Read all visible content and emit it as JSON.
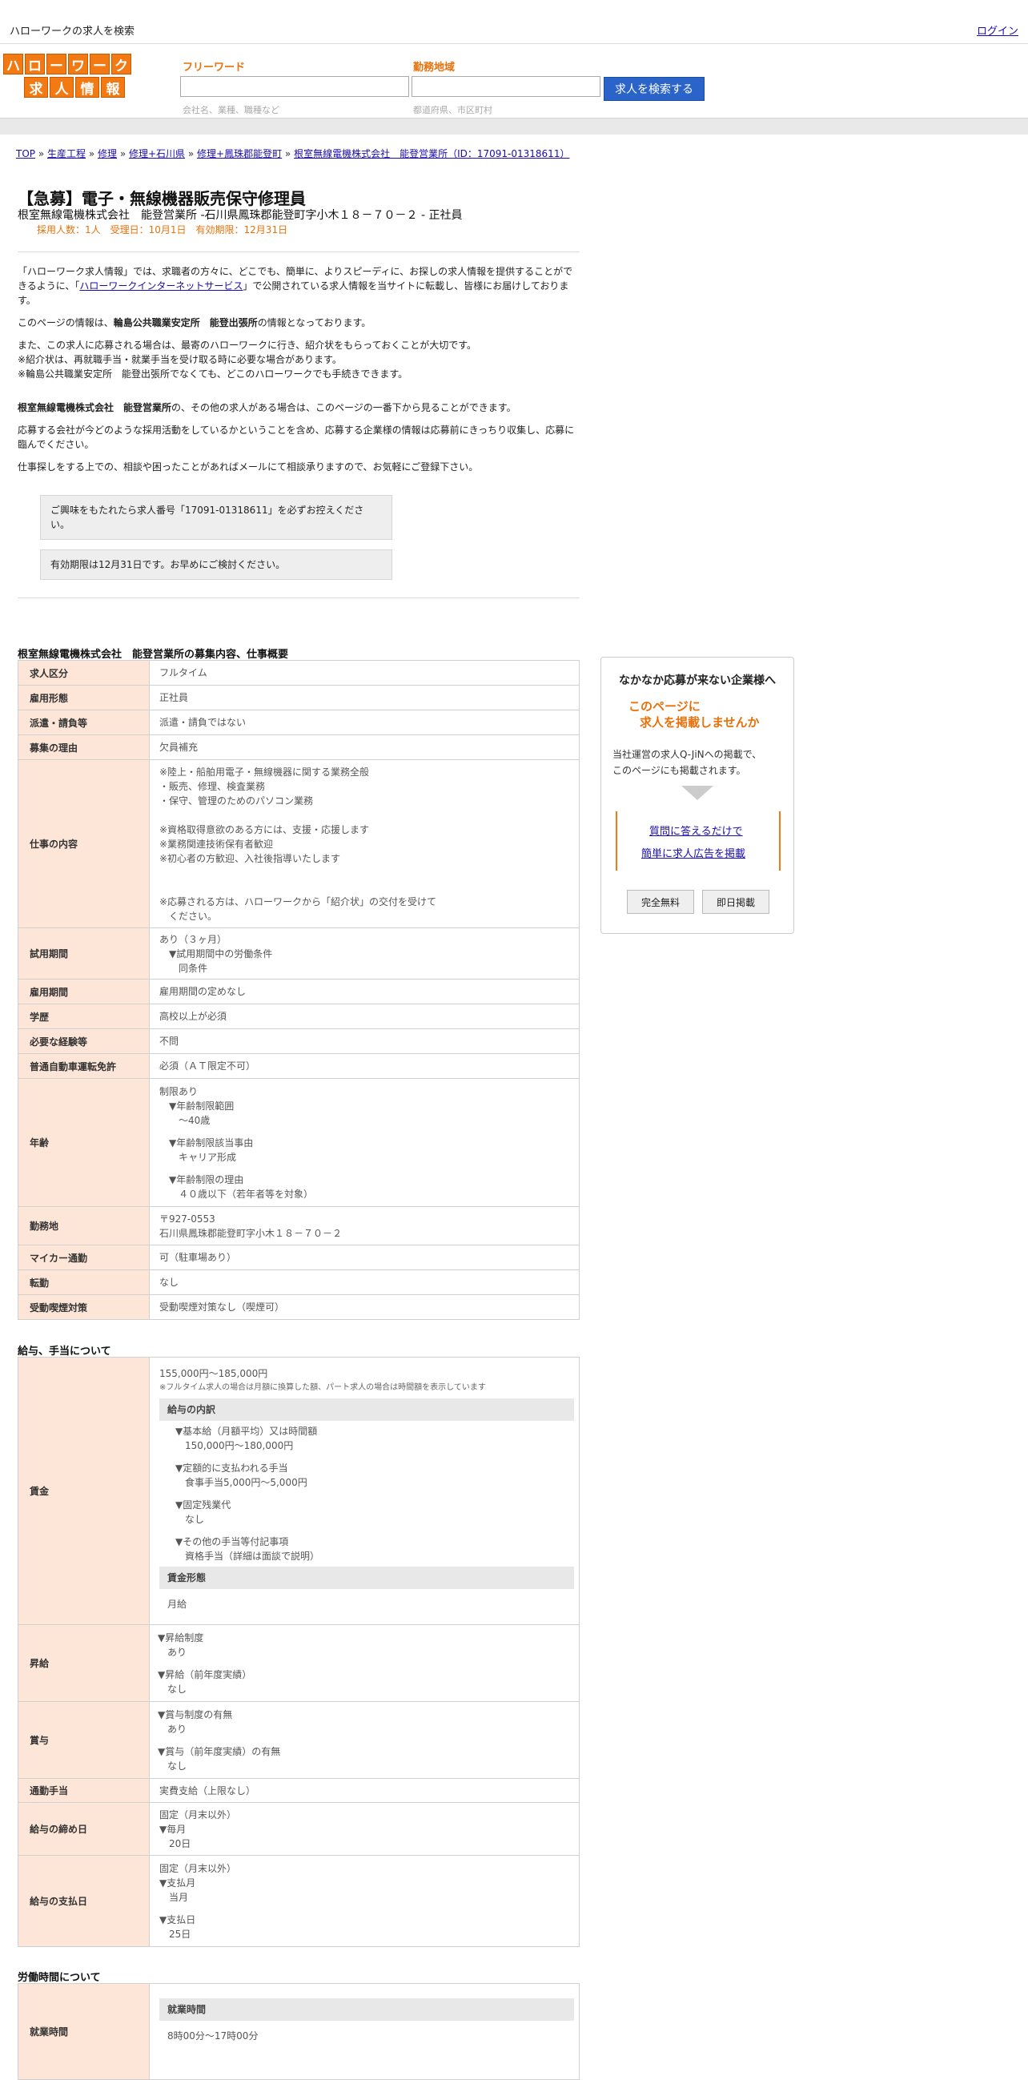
{
  "topbar": {
    "site": "ハローワークの求人を検索",
    "login": "ログイン"
  },
  "logo": {
    "row1": [
      "ハ",
      "ロ",
      "ー",
      "ワ",
      "ー",
      "ク"
    ],
    "row2": [
      "求",
      "人",
      "情",
      "報"
    ]
  },
  "search": {
    "freeword_label": "フリーワード",
    "freeword_hint": "会社名、業種、職種など",
    "area_label": "勤務地域",
    "area_hint": "都道府県、市区町村",
    "button": "求人を検索する"
  },
  "breadcrumb": [
    "TOP",
    "生産工程",
    "修理",
    "修理+石川県",
    "修理+鳳珠郡能登町",
    "根室無線電機株式会社　能登営業所（ID：17091-01318611）"
  ],
  "job": {
    "title": "【急募】電子・無線機器販売保守修理員",
    "subtitle": "根室無線電機株式会社　能登営業所 -石川県鳳珠郡能登町字小木１８－７０－２ - 正社員",
    "meta": "採用人数：1人　受理日：10月1日　有効期限：12月31日"
  },
  "intro": {
    "p1a": "「ハローワーク求人情報」では、求職者の方々に、どこでも、簡単に、よりスピーディに、お探しの求人情報を提供することができるように、「",
    "p1link": "ハローワークインターネットサービス",
    "p1b": "」で公開されている求人情報を当サイトに転載し、皆様にお届けしております。",
    "p2a": "このページの情報は、",
    "p2b": "輪島公共職業安定所　能登出張所",
    "p2c": "の情報となっております。",
    "p3": [
      "また、この求人に応募される場合は、最寄のハローワークに行き、紹介状をもらっておくことが大切です。",
      "※紹介状は、再就職手当・就業手当を受け取る時に必要な場合があります。",
      "※輪島公共職業安定所　能登出張所でなくても、どこのハローワークでも手続きできます。"
    ],
    "p4a": "根室無線電機株式会社　能登営業所",
    "p4b": "の、その他の求人がある場合は、このページの一番下から見ることができます。",
    "p5": "応募する会社が今どのような採用活動をしているかということを含め、応募する企業様の情報は応募前にきっちり収集し、応募に臨んでください。",
    "p6": "仕事探しをする上での、相談や困ったことがあればメールにて相談承りますので、お気軽にご登録下さい。",
    "notice1": "ご興味をもたれたら求人番号「17091-01318611」を必ずお控えください。",
    "notice2": "有効期限は12月31日です。お早めにご検討ください。"
  },
  "section1": {
    "title": "根室無線電機株式会社　能登営業所の募集内容、仕事概要",
    "rows": [
      {
        "k": "求人区分",
        "v": [
          "フルタイム"
        ]
      },
      {
        "k": "雇用形態",
        "v": [
          "正社員"
        ]
      },
      {
        "k": "派遣・請負等",
        "v": [
          "派遣・請負ではない"
        ]
      },
      {
        "k": "募集の理由",
        "v": [
          "欠員補充"
        ]
      },
      {
        "k": "仕事の内容",
        "v": [
          "※陸上・船舶用電子・無線機器に関する業務全般",
          "・販売、修理、検査業務",
          "・保守、管理のためのパソコン業務",
          "",
          "※資格取得意欲のある方には、支援・応援します",
          "※業務関連技術保有者歓迎",
          "※初心者の方歓迎、入社後指導いたします",
          "",
          "",
          "※応募される方は、ハローワークから「紹介状」の交付を受けて",
          "　ください。"
        ]
      },
      {
        "k": "試用期間",
        "v": [
          "あり（３ヶ月）",
          "　▼試用期間中の労働条件",
          "　　同条件"
        ]
      },
      {
        "k": "雇用期間",
        "v": [
          "雇用期間の定めなし"
        ]
      },
      {
        "k": "学歴",
        "v": [
          "高校以上が必須"
        ]
      },
      {
        "k": "必要な経験等",
        "v": [
          "不問"
        ]
      },
      {
        "k": "普通自動車運転免許",
        "v": [
          "必須（ＡＴ限定不可）"
        ]
      },
      {
        "k": "年齢",
        "v": [
          "制限あり",
          "　▼年齢制限範囲",
          "　　〜40歳",
          "",
          "　▼年齢制限該当事由",
          "　　キャリア形成",
          "",
          "　▼年齢制限の理由",
          "　　４０歳以下（若年者等を対象）"
        ]
      },
      {
        "k": "勤務地",
        "v": [
          "〒927-0553",
          "石川県鳳珠郡能登町字小木１８－７０－２"
        ]
      },
      {
        "k": "マイカー通勤",
        "v": [
          "可（駐車場あり）"
        ]
      },
      {
        "k": "転勤",
        "v": [
          "なし"
        ]
      },
      {
        "k": "受動喫煙対策",
        "v": [
          "受動喫煙対策なし（喫煙可）"
        ]
      }
    ]
  },
  "section2": {
    "title": "給与、手当について",
    "wage_label": "賃金",
    "wage_range": "155,000円〜185,000円",
    "wage_note": "※フルタイム求人の場合は月額に換算した額、パート求人の場合は時間額を表示しています",
    "breakdown_head": "給与の内訳",
    "breakdown": [
      "▼基本給（月額平均）又は時間額",
      "　150,000円〜180,000円",
      "",
      "▼定額的に支払われる手当",
      "　食事手当5,000円〜5,000円",
      "",
      "▼固定残業代",
      "　なし",
      "",
      "▼その他の手当等付記事項",
      "　資格手当（詳細は面談で説明）"
    ],
    "form_head": "賃金形態",
    "form": "月給",
    "rows": [
      {
        "k": "昇給",
        "v": [
          "▼昇給制度",
          "　あり",
          "",
          "▼昇給（前年度実績）",
          "　なし"
        ]
      },
      {
        "k": "賞与",
        "v": [
          "▼賞与制度の有無",
          "　あり",
          "",
          "▼賞与（前年度実績）の有無",
          "　なし"
        ]
      },
      {
        "k": "通勤手当",
        "v": [
          "実費支給（上限なし）"
        ]
      },
      {
        "k": "給与の締め日",
        "v": [
          "固定（月末以外）",
          "▼毎月",
          "　20日"
        ]
      },
      {
        "k": "給与の支払日",
        "v": [
          "固定（月末以外）",
          "▼支払月",
          "　当月",
          "",
          "▼支払日",
          "　25日"
        ]
      }
    ]
  },
  "section3": {
    "title": "労働時間について",
    "hours_label": "就業時間",
    "hours_head": "就業時間",
    "hours": "8時00分〜17時00分"
  },
  "ad": {
    "heading": "なかなか応募が来ない企業様へ",
    "orange1": "このページに",
    "orange2": "求人を掲載しませんか",
    "text1": "当社運営の求人Q-JiNへの掲載で、",
    "text2": "このページにも掲載されます。",
    "link1": "質問に答えるだけで",
    "link2": "簡単に求人広告を掲載",
    "btn1": "完全無料",
    "btn2": "即日掲載"
  }
}
